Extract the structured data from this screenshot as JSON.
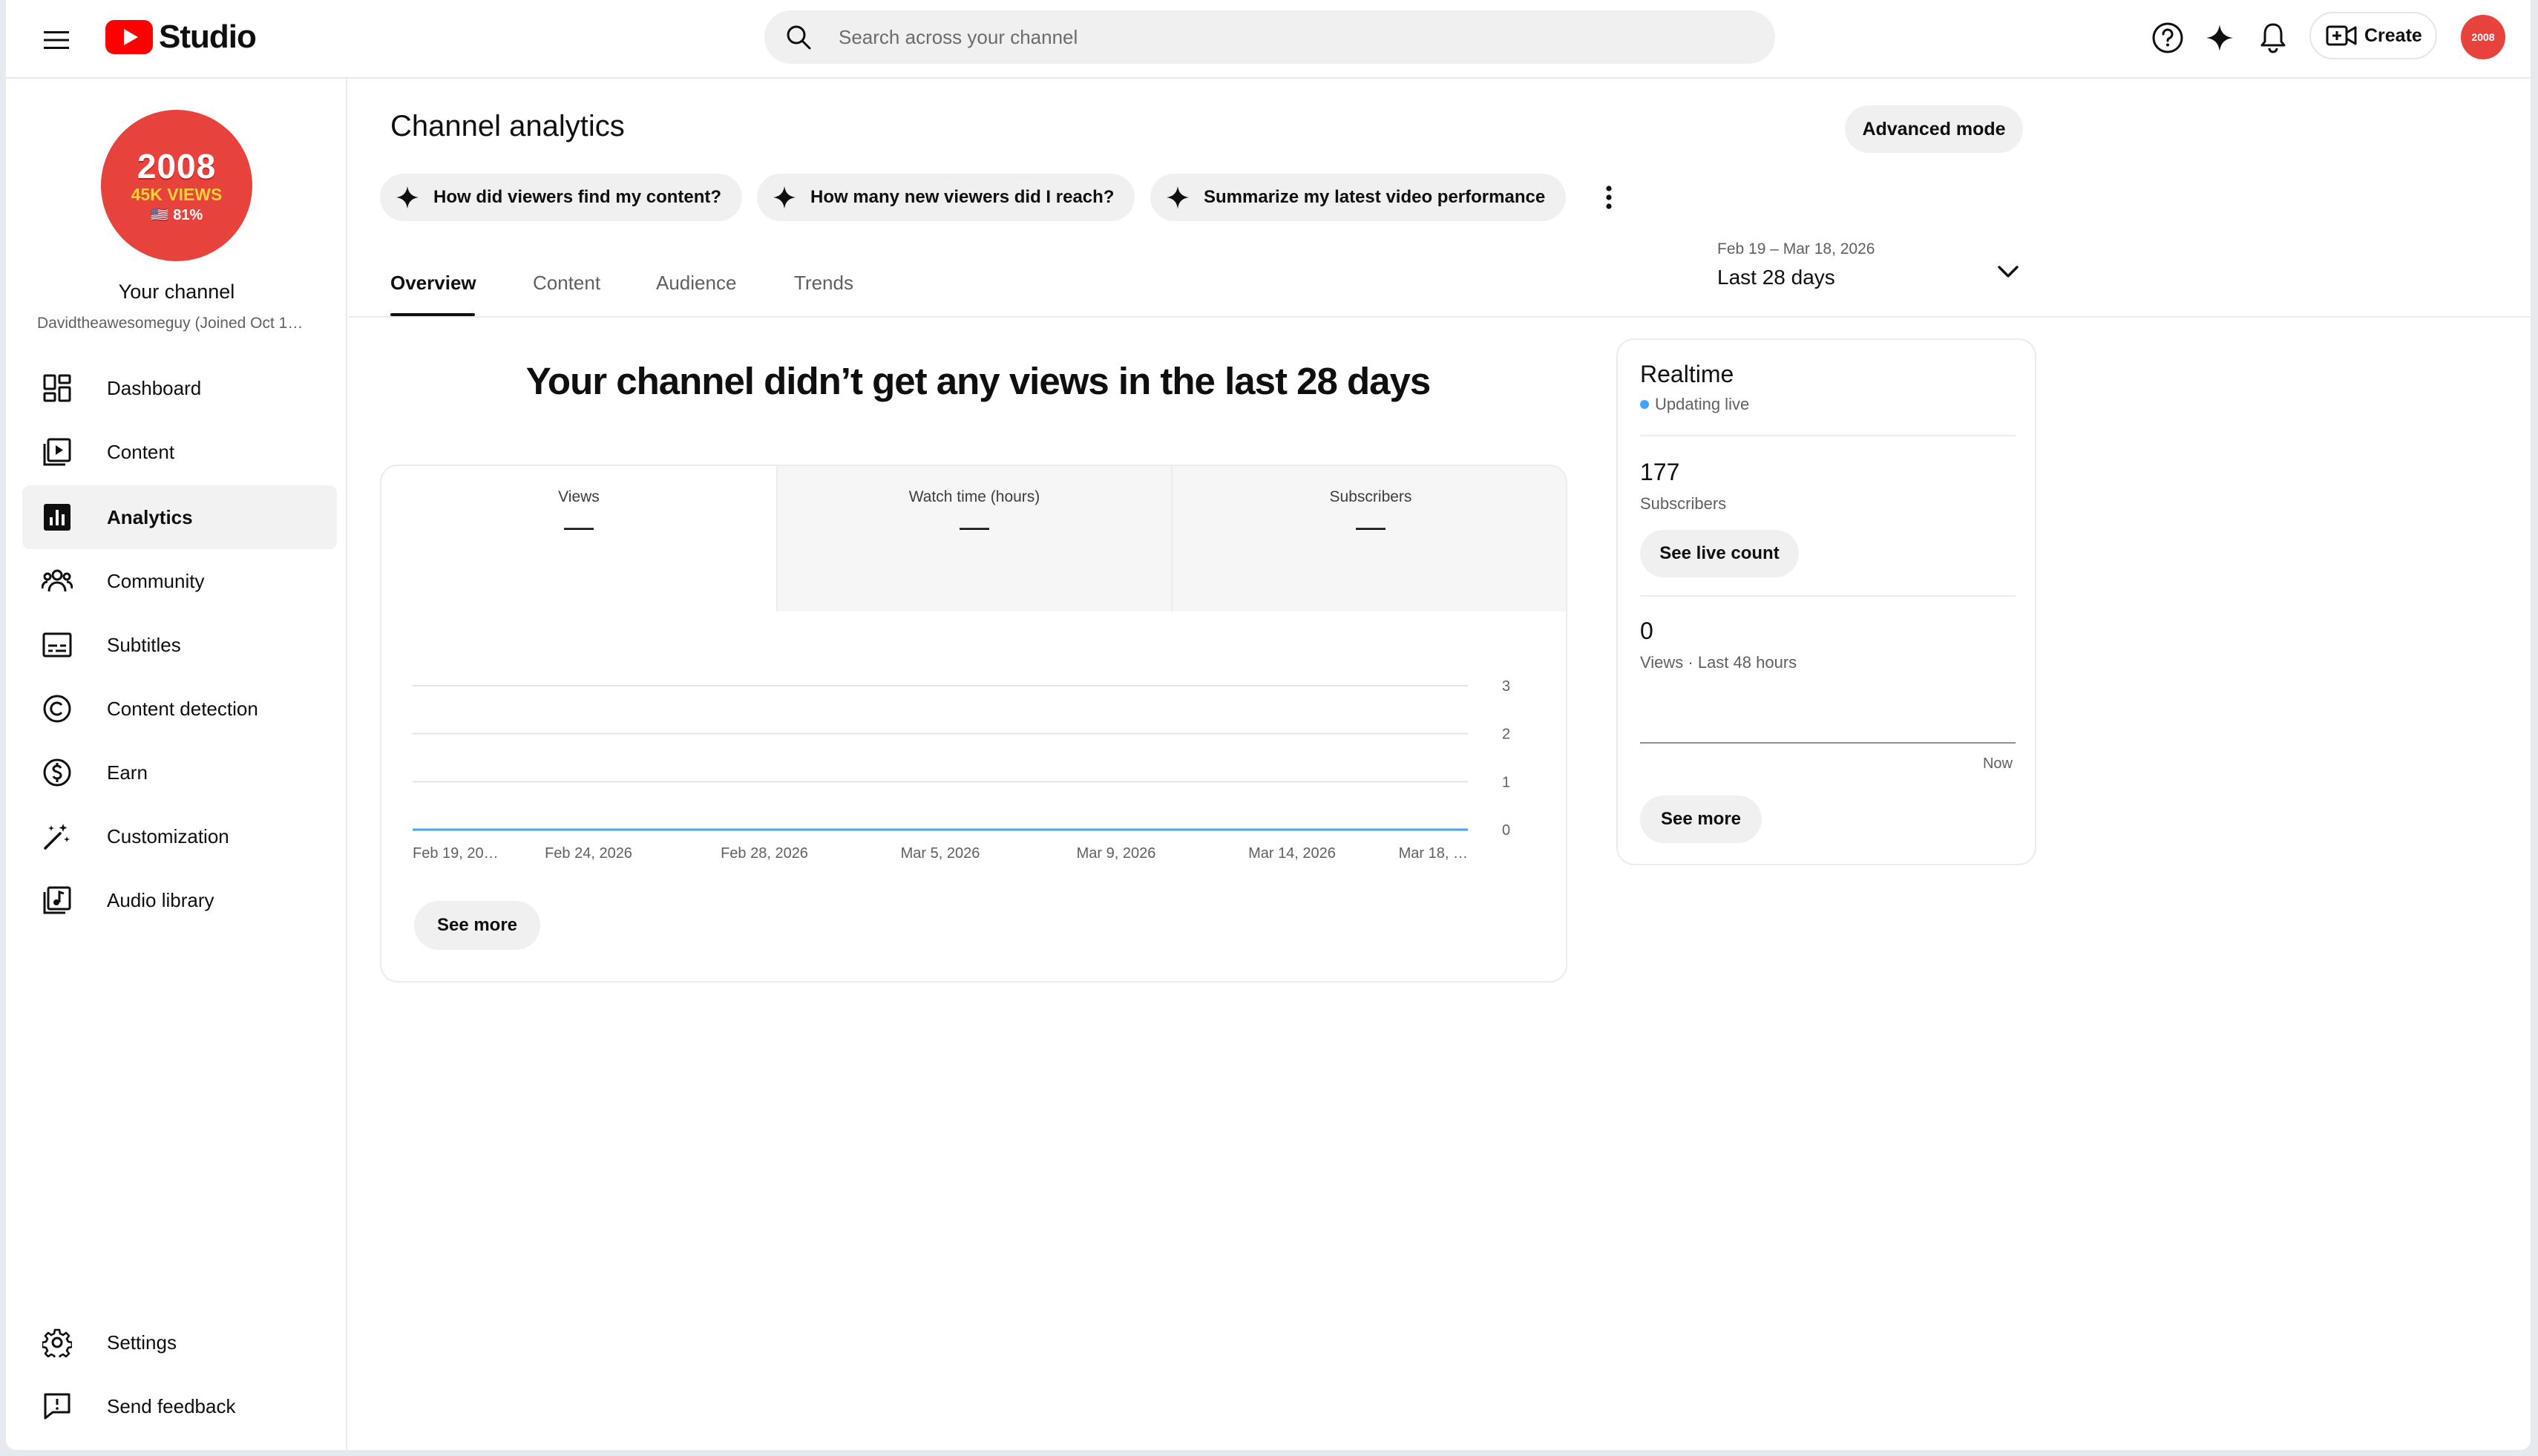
{
  "header": {
    "logo_text": "Studio",
    "search_placeholder": "Search across your channel",
    "create_label": "Create"
  },
  "sidebar": {
    "channel_avatar": {
      "line1": "2008",
      "line2": "45K VIEWS",
      "line3": "🇺🇸 81%"
    },
    "channel_title": "Your channel",
    "channel_subtitle": "Davidtheawesomeguy (Joined Oct 1…",
    "items": [
      {
        "label": "Dashboard",
        "icon": "dashboard-icon"
      },
      {
        "label": "Content",
        "icon": "content-icon"
      },
      {
        "label": "Analytics",
        "icon": "analytics-icon",
        "active": true
      },
      {
        "label": "Community",
        "icon": "community-icon"
      },
      {
        "label": "Subtitles",
        "icon": "subtitles-icon"
      },
      {
        "label": "Content detection",
        "icon": "copyright-icon"
      },
      {
        "label": "Earn",
        "icon": "dollar-icon"
      },
      {
        "label": "Customization",
        "icon": "magic-wand-icon"
      },
      {
        "label": "Audio library",
        "icon": "audio-library-icon"
      }
    ],
    "bottom_items": [
      {
        "label": "Settings",
        "icon": "gear-icon"
      },
      {
        "label": "Send feedback",
        "icon": "feedback-icon"
      }
    ]
  },
  "main": {
    "title": "Channel analytics",
    "advanced_mode_label": "Advanced mode",
    "chips": [
      "How did viewers find my content?",
      "How many new viewers did I reach?",
      "Summarize my latest video performance"
    ],
    "tabs": [
      "Overview",
      "Content",
      "Audience",
      "Trends"
    ],
    "active_tab": "Overview",
    "date_range": "Feb 19 – Mar 18, 2026",
    "date_period": "Last 28 days",
    "empty_headline": "Your channel didn’t get any views in the last 28 days",
    "metrics": [
      {
        "label": "Views",
        "value": "—"
      },
      {
        "label": "Watch time (hours)",
        "value": "—"
      },
      {
        "label": "Subscribers",
        "value": "—"
      }
    ],
    "see_more_label": "See more"
  },
  "chart_data": {
    "type": "line",
    "x_tick_labels": [
      "Feb 19, 20…",
      "Feb 24, 2026",
      "Feb 28, 2026",
      "Mar 5, 2026",
      "Mar 9, 2026",
      "Mar 14, 2026",
      "Mar 18, …"
    ],
    "y_ticks": [
      0,
      1,
      2,
      3
    ],
    "ylim": [
      0,
      3
    ],
    "series": [
      {
        "values": [
          0,
          0,
          0,
          0,
          0,
          0,
          0
        ],
        "color": "#3ea6ff"
      }
    ],
    "grid": true
  },
  "realtime": {
    "title": "Realtime",
    "status": "Updating live",
    "subscribers_value": "177",
    "subscribers_label": "Subscribers",
    "see_live_count_label": "See live count",
    "views_value": "0",
    "views_label": "Views · Last 48 hours",
    "now_label": "Now",
    "see_more_label": "See more"
  }
}
